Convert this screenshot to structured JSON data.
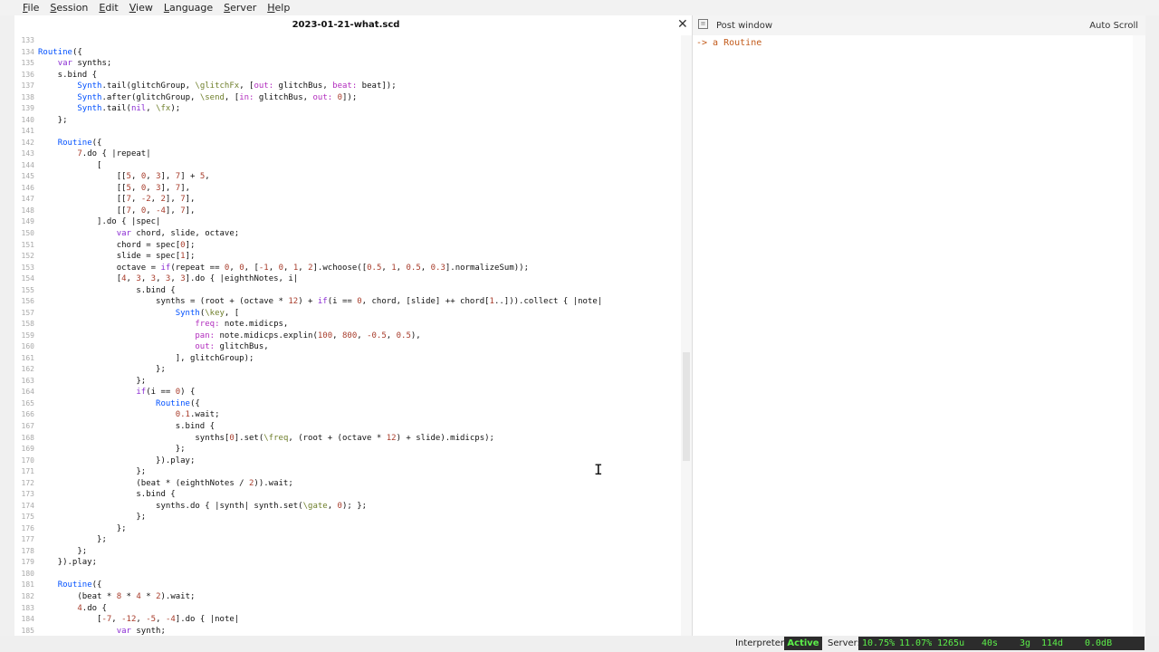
{
  "menu": [
    "File",
    "Session",
    "Edit",
    "View",
    "Language",
    "Server",
    "Help"
  ],
  "editor": {
    "title": "2023-01-21-what.scd",
    "close_icon": "✕",
    "cursor_glyph": "I",
    "lines": [
      {
        "n": "133",
        "html": ""
      },
      {
        "n": "134",
        "html": "<span class='k'>Routine</span>({"
      },
      {
        "n": "135",
        "html": "    <span class='c'>var</span> synths;"
      },
      {
        "n": "136",
        "html": "    s.bind {"
      },
      {
        "n": "137",
        "html": "        <span class='k'>Synth</span>.tail(glitchGroup, <span class='s'>\\glitchFx</span>, [<span class='n'>out:</span> glitchBus, <span class='n'>beat:</span> beat]);"
      },
      {
        "n": "138",
        "html": "        <span class='k'>Synth</span>.after(glitchGroup, <span class='s'>\\send</span>, [<span class='n'>in:</span> glitchBus, <span class='n'>out:</span> <span class='v'>0</span>]);"
      },
      {
        "n": "139",
        "html": "        <span class='k'>Synth</span>.tail(<span class='c'>nil</span>, <span class='s'>\\fx</span>);"
      },
      {
        "n": "140",
        "html": "    };"
      },
      {
        "n": "141",
        "html": ""
      },
      {
        "n": "142",
        "html": "    <span class='k'>Routine</span>({"
      },
      {
        "n": "143",
        "html": "        <span class='v'>7</span>.do { |repeat|"
      },
      {
        "n": "144",
        "html": "            ["
      },
      {
        "n": "145",
        "html": "                [[<span class='v'>5</span>, <span class='v'>0</span>, <span class='v'>3</span>], <span class='v'>7</span>] + <span class='v'>5</span>,"
      },
      {
        "n": "146",
        "html": "                [[<span class='v'>5</span>, <span class='v'>0</span>, <span class='v'>3</span>], <span class='v'>7</span>],"
      },
      {
        "n": "147",
        "html": "                [[<span class='v'>7</span>, <span class='v'>-2</span>, <span class='v'>2</span>], <span class='v'>7</span>],"
      },
      {
        "n": "148",
        "html": "                [[<span class='v'>7</span>, <span class='v'>0</span>, <span class='v'>-4</span>], <span class='v'>7</span>],"
      },
      {
        "n": "149",
        "html": "            ].do { |spec|"
      },
      {
        "n": "150",
        "html": "                <span class='c'>var</span> chord, slide, octave;"
      },
      {
        "n": "151",
        "html": "                chord = spec[<span class='v'>0</span>];"
      },
      {
        "n": "152",
        "html": "                slide = spec[<span class='v'>1</span>];"
      },
      {
        "n": "153",
        "html": "                octave = <span class='c'>if</span>(repeat == <span class='v'>0</span>, <span class='v'>0</span>, [<span class='v'>-1</span>, <span class='v'>0</span>, <span class='v'>1</span>, <span class='v'>2</span>].wchoose([<span class='v'>0.5</span>, <span class='v'>1</span>, <span class='v'>0.5</span>, <span class='v'>0.3</span>].normalizeSum));"
      },
      {
        "n": "154",
        "html": "                [<span class='v'>4</span>, <span class='v'>3</span>, <span class='v'>3</span>, <span class='v'>3</span>, <span class='v'>3</span>].do { |eighthNotes, i|"
      },
      {
        "n": "155",
        "html": "                    s.bind {"
      },
      {
        "n": "156",
        "html": "                        synths = (root + (octave * <span class='v'>12</span>) + <span class='c'>if</span>(i == <span class='v'>0</span>, chord, [slide] ++ chord[<span class='v'>1</span>..])).collect { |note|"
      },
      {
        "n": "157",
        "html": "                            <span class='k'>Synth</span>(<span class='s'>\\key</span>, ["
      },
      {
        "n": "158",
        "html": "                                <span class='n'>freq:</span> note.midicps,"
      },
      {
        "n": "159",
        "html": "                                <span class='n'>pan:</span> note.midicps.explin(<span class='v'>100</span>, <span class='v'>800</span>, <span class='v'>-0.5</span>, <span class='v'>0.5</span>),"
      },
      {
        "n": "160",
        "html": "                                <span class='n'>out:</span> glitchBus,"
      },
      {
        "n": "161",
        "html": "                            ], glitchGroup);"
      },
      {
        "n": "162",
        "html": "                        };"
      },
      {
        "n": "163",
        "html": "                    };"
      },
      {
        "n": "164",
        "html": "                    <span class='c'>if</span>(i == <span class='v'>0</span>) {"
      },
      {
        "n": "165",
        "html": "                        <span class='k'>Routine</span>({"
      },
      {
        "n": "166",
        "html": "                            <span class='v'>0.1</span>.wait;"
      },
      {
        "n": "167",
        "html": "                            s.bind {"
      },
      {
        "n": "168",
        "html": "                                synths[<span class='v'>0</span>].set(<span class='s'>\\freq</span>, (root + (octave * <span class='v'>12</span>) + slide).midicps);"
      },
      {
        "n": "169",
        "html": "                            };"
      },
      {
        "n": "170",
        "html": "                        }).play;"
      },
      {
        "n": "171",
        "html": "                    };"
      },
      {
        "n": "172",
        "html": "                    (beat * (eighthNotes / <span class='v'>2</span>)).wait;"
      },
      {
        "n": "173",
        "html": "                    s.bind {"
      },
      {
        "n": "174",
        "html": "                        synths.do { |synth| synth.set(<span class='s'>\\gate</span>, <span class='v'>0</span>); };"
      },
      {
        "n": "175",
        "html": "                    };"
      },
      {
        "n": "176",
        "html": "                };"
      },
      {
        "n": "177",
        "html": "            };"
      },
      {
        "n": "178",
        "html": "        };"
      },
      {
        "n": "179",
        "html": "    }).play;"
      },
      {
        "n": "180",
        "html": ""
      },
      {
        "n": "181",
        "html": "    <span class='k'>Routine</span>({"
      },
      {
        "n": "182",
        "html": "        (beat * <span class='v'>8</span> * <span class='v'>4</span> * <span class='v'>2</span>).wait;"
      },
      {
        "n": "183",
        "html": "        <span class='v'>4</span>.do {"
      },
      {
        "n": "184",
        "html": "            [<span class='v'>-7</span>, <span class='v'>-12</span>, <span class='v'>-5</span>, <span class='v'>-4</span>].do { |note|"
      },
      {
        "n": "185",
        "html": "                <span class='c'>var</span> synth;"
      }
    ]
  },
  "post": {
    "title": "Post window",
    "autoscroll": "Auto Scroll",
    "output": "-> a Routine"
  },
  "status": {
    "interpreter_label": "Interpreter:",
    "interpreter_state": "Active",
    "server_label": "Server:",
    "avg_cpu": "10.75%",
    "peak_cpu": "11.07%",
    "ugens": "1265u",
    "synths": "40s",
    "groups": "3g",
    "synthdefs": "114d",
    "volume": "0.0dB"
  }
}
